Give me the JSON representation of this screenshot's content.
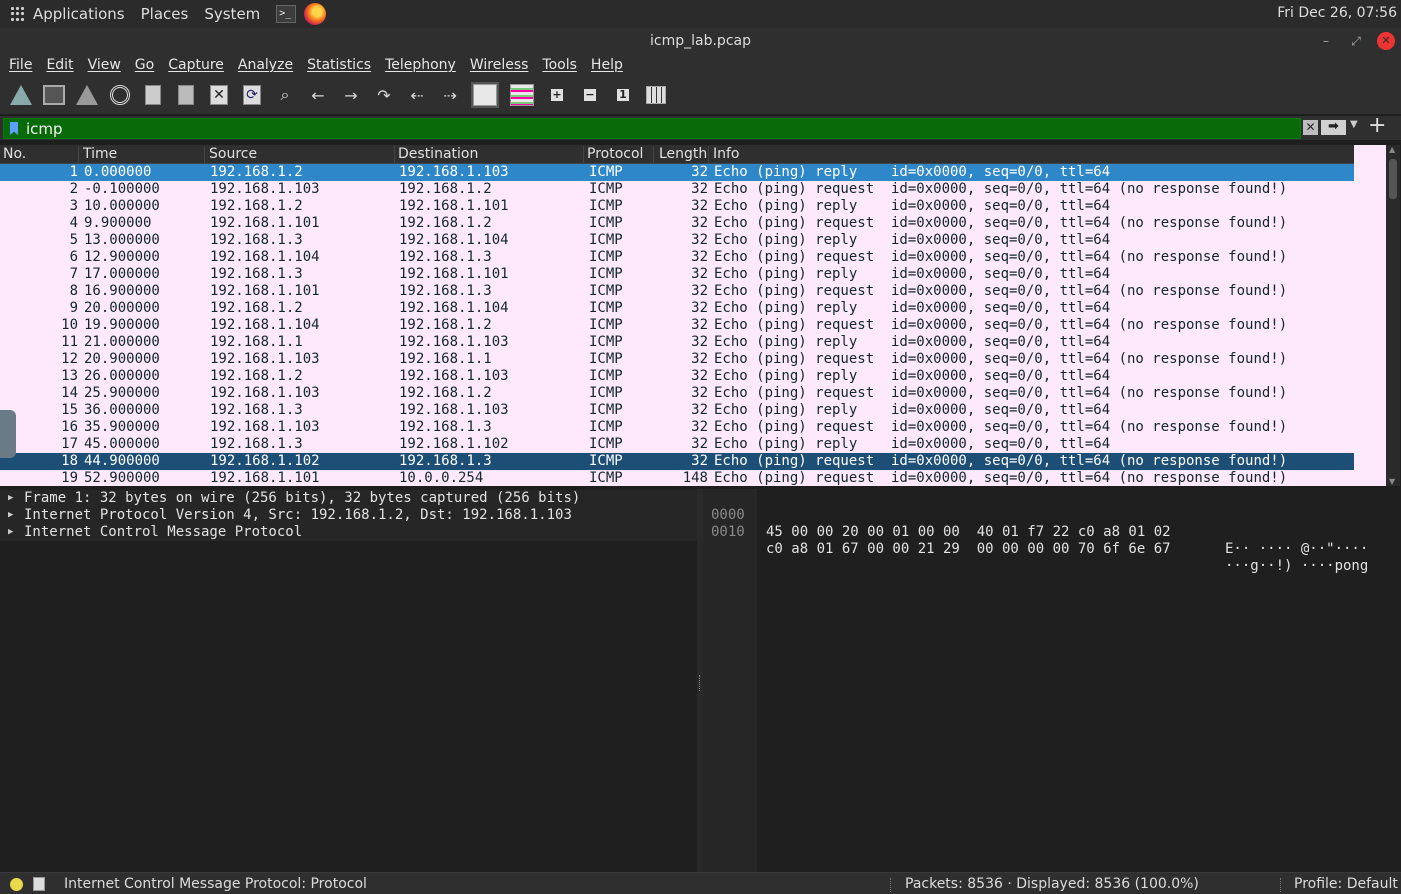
{
  "desktop": {
    "menus": [
      "Applications",
      "Places",
      "System"
    ],
    "clock": "Fri Dec 26, 07:56"
  },
  "window": {
    "title": "icmp_lab.pcap",
    "controls": {
      "minimize": "–",
      "maximize": "⤢",
      "close": "✕"
    }
  },
  "menubar": [
    "File",
    "Edit",
    "View",
    "Go",
    "Capture",
    "Analyze",
    "Statistics",
    "Telephony",
    "Wireless",
    "Tools",
    "Help"
  ],
  "toolbar": {
    "icons": [
      "start-capture-icon",
      "stop-capture-icon",
      "restart-capture-icon",
      "capture-options-icon",
      "open-file-icon",
      "save-file-icon",
      "close-file-icon",
      "reload-file-icon",
      "find-packet-icon",
      "go-back-icon",
      "go-forward-icon",
      "go-to-packet-icon",
      "go-first-icon",
      "go-last-icon",
      "auto-scroll-icon",
      "colorize-icon",
      "zoom-in-icon",
      "zoom-out-icon",
      "normal-size-icon",
      "resize-columns-icon"
    ]
  },
  "filter": {
    "value": "icmp",
    "bg_color": "#086b08"
  },
  "packet_list": {
    "columns": [
      "No.",
      "Time",
      "Source",
      "Destination",
      "Protocol",
      "Length",
      "Info"
    ],
    "selected_color": "#2d87c9",
    "row_color": "#fde8fc",
    "rows": [
      {
        "no": "1",
        "time": "0.000000",
        "src": "192.168.1.2",
        "dst": "192.168.1.103",
        "proto": "ICMP",
        "len": "32",
        "info": "Echo (ping) reply    id=0x0000, seq=0/0, ttl=64",
        "state": "selected"
      },
      {
        "no": "2",
        "time": "-0.100000",
        "src": "192.168.1.103",
        "dst": "192.168.1.2",
        "proto": "ICMP",
        "len": "32",
        "info": "Echo (ping) request  id=0x0000, seq=0/0, ttl=64 (no response found!)",
        "state": ""
      },
      {
        "no": "3",
        "time": "10.000000",
        "src": "192.168.1.2",
        "dst": "192.168.1.101",
        "proto": "ICMP",
        "len": "32",
        "info": "Echo (ping) reply    id=0x0000, seq=0/0, ttl=64",
        "state": ""
      },
      {
        "no": "4",
        "time": "9.900000",
        "src": "192.168.1.101",
        "dst": "192.168.1.2",
        "proto": "ICMP",
        "len": "32",
        "info": "Echo (ping) request  id=0x0000, seq=0/0, ttl=64 (no response found!)",
        "state": ""
      },
      {
        "no": "5",
        "time": "13.000000",
        "src": "192.168.1.3",
        "dst": "192.168.1.104",
        "proto": "ICMP",
        "len": "32",
        "info": "Echo (ping) reply    id=0x0000, seq=0/0, ttl=64",
        "state": ""
      },
      {
        "no": "6",
        "time": "12.900000",
        "src": "192.168.1.104",
        "dst": "192.168.1.3",
        "proto": "ICMP",
        "len": "32",
        "info": "Echo (ping) request  id=0x0000, seq=0/0, ttl=64 (no response found!)",
        "state": ""
      },
      {
        "no": "7",
        "time": "17.000000",
        "src": "192.168.1.3",
        "dst": "192.168.1.101",
        "proto": "ICMP",
        "len": "32",
        "info": "Echo (ping) reply    id=0x0000, seq=0/0, ttl=64",
        "state": ""
      },
      {
        "no": "8",
        "time": "16.900000",
        "src": "192.168.1.101",
        "dst": "192.168.1.3",
        "proto": "ICMP",
        "len": "32",
        "info": "Echo (ping) request  id=0x0000, seq=0/0, ttl=64 (no response found!)",
        "state": ""
      },
      {
        "no": "9",
        "time": "20.000000",
        "src": "192.168.1.2",
        "dst": "192.168.1.104",
        "proto": "ICMP",
        "len": "32",
        "info": "Echo (ping) reply    id=0x0000, seq=0/0, ttl=64",
        "state": ""
      },
      {
        "no": "10",
        "time": "19.900000",
        "src": "192.168.1.104",
        "dst": "192.168.1.2",
        "proto": "ICMP",
        "len": "32",
        "info": "Echo (ping) request  id=0x0000, seq=0/0, ttl=64 (no response found!)",
        "state": ""
      },
      {
        "no": "11",
        "time": "21.000000",
        "src": "192.168.1.1",
        "dst": "192.168.1.103",
        "proto": "ICMP",
        "len": "32",
        "info": "Echo (ping) reply    id=0x0000, seq=0/0, ttl=64",
        "state": ""
      },
      {
        "no": "12",
        "time": "20.900000",
        "src": "192.168.1.103",
        "dst": "192.168.1.1",
        "proto": "ICMP",
        "len": "32",
        "info": "Echo (ping) request  id=0x0000, seq=0/0, ttl=64 (no response found!)",
        "state": ""
      },
      {
        "no": "13",
        "time": "26.000000",
        "src": "192.168.1.2",
        "dst": "192.168.1.103",
        "proto": "ICMP",
        "len": "32",
        "info": "Echo (ping) reply    id=0x0000, seq=0/0, ttl=64",
        "state": ""
      },
      {
        "no": "14",
        "time": "25.900000",
        "src": "192.168.1.103",
        "dst": "192.168.1.2",
        "proto": "ICMP",
        "len": "32",
        "info": "Echo (ping) request  id=0x0000, seq=0/0, ttl=64 (no response found!)",
        "state": ""
      },
      {
        "no": "15",
        "time": "36.000000",
        "src": "192.168.1.3",
        "dst": "192.168.1.103",
        "proto": "ICMP",
        "len": "32",
        "info": "Echo (ping) reply    id=0x0000, seq=0/0, ttl=64",
        "state": ""
      },
      {
        "no": "16",
        "time": "35.900000",
        "src": "192.168.1.103",
        "dst": "192.168.1.3",
        "proto": "ICMP",
        "len": "32",
        "info": "Echo (ping) request  id=0x0000, seq=0/0, ttl=64 (no response found!)",
        "state": ""
      },
      {
        "no": "17",
        "time": "45.000000",
        "src": "192.168.1.3",
        "dst": "192.168.1.102",
        "proto": "ICMP",
        "len": "32",
        "info": "Echo (ping) reply    id=0x0000, seq=0/0, ttl=64",
        "state": ""
      },
      {
        "no": "18",
        "time": "44.900000",
        "src": "192.168.1.102",
        "dst": "192.168.1.3",
        "proto": "ICMP",
        "len": "32",
        "info": "Echo (ping) request  id=0x0000, seq=0/0, ttl=64 (no response found!)",
        "state": "marked"
      },
      {
        "no": "19",
        "time": "52.900000",
        "src": "192.168.1.101",
        "dst": "10.0.0.254",
        "proto": "ICMP",
        "len": "148",
        "info": "Echo (ping) request  id=0x0000, seq=0/0, ttl=64 (no response found!)",
        "state": ""
      }
    ]
  },
  "details": [
    "Frame 1: 32 bytes on wire (256 bits), 32 bytes captured (256 bits)",
    "Internet Protocol Version 4, Src: 192.168.1.2, Dst: 192.168.1.103",
    "Internet Control Message Protocol"
  ],
  "bytes": [
    {
      "offset": "0000",
      "hex": "45 00 00 20 00 01 00 00  40 01 f7 22 c0 a8 01 02",
      "ascii": "E·· ···· @··\"····"
    },
    {
      "offset": "0010",
      "hex": "c0 a8 01 67 00 00 21 29  00 00 00 00 70 6f 6e 67",
      "ascii": "···g··!) ····pong"
    }
  ],
  "statusbar": {
    "field": "Internet Control Message Protocol: Protocol",
    "packets": "Packets: 8536 · Displayed: 8536 (100.0%)",
    "profile": "Profile: Default"
  }
}
